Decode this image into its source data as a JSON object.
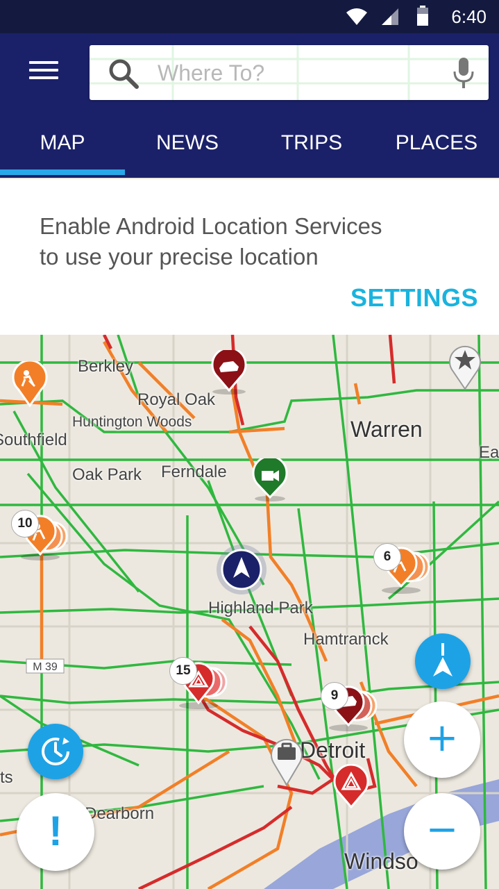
{
  "status_bar": {
    "time": "6:40",
    "icons": [
      "wifi-icon",
      "cell-signal-icon",
      "battery-icon"
    ]
  },
  "header": {
    "menu_icon": "hamburger-menu-icon",
    "search": {
      "placeholder": "Where To?",
      "value": "",
      "left_icon": "search-icon",
      "right_icon": "microphone-icon"
    },
    "tabs": [
      {
        "label": "MAP",
        "selected": true
      },
      {
        "label": "NEWS",
        "selected": false
      },
      {
        "label": "TRIPS",
        "selected": false
      },
      {
        "label": "PLACES",
        "selected": false
      }
    ],
    "tab_indicator_color": "#29a8e8",
    "bar_color": "#1b2168"
  },
  "banner": {
    "line1": "Enable Android Location Services",
    "line2": "to use your precise location",
    "action": "SETTINGS",
    "action_color": "#1ab3de"
  },
  "map": {
    "places": [
      {
        "name": "Berkley"
      },
      {
        "name": "Royal Oak"
      },
      {
        "name": "Huntington Woods"
      },
      {
        "name": "Southfield"
      },
      {
        "name": "Warren"
      },
      {
        "name": "Ea"
      },
      {
        "name": "Oak Park"
      },
      {
        "name": "Ferndale"
      },
      {
        "name": "Highland Park"
      },
      {
        "name": "Hamtramck"
      },
      {
        "name": "Detroit"
      },
      {
        "name": "Dearborn"
      },
      {
        "name": "Windso"
      },
      {
        "name": "ts"
      }
    ],
    "road_shield": "M 39",
    "clusters": [
      {
        "type": "construction",
        "count": "10"
      },
      {
        "type": "construction",
        "count": "6"
      },
      {
        "type": "hazard",
        "count": "15"
      },
      {
        "type": "crash",
        "count": "9"
      }
    ],
    "traffic_colors": {
      "free": "#2fb83f",
      "slow": "#f27f27",
      "jam": "#d62b2b"
    }
  },
  "controls": {
    "compass": "compass-north-icon",
    "zoom_in": "+",
    "zoom_out": "−",
    "report": "!",
    "history": "history-icon"
  }
}
